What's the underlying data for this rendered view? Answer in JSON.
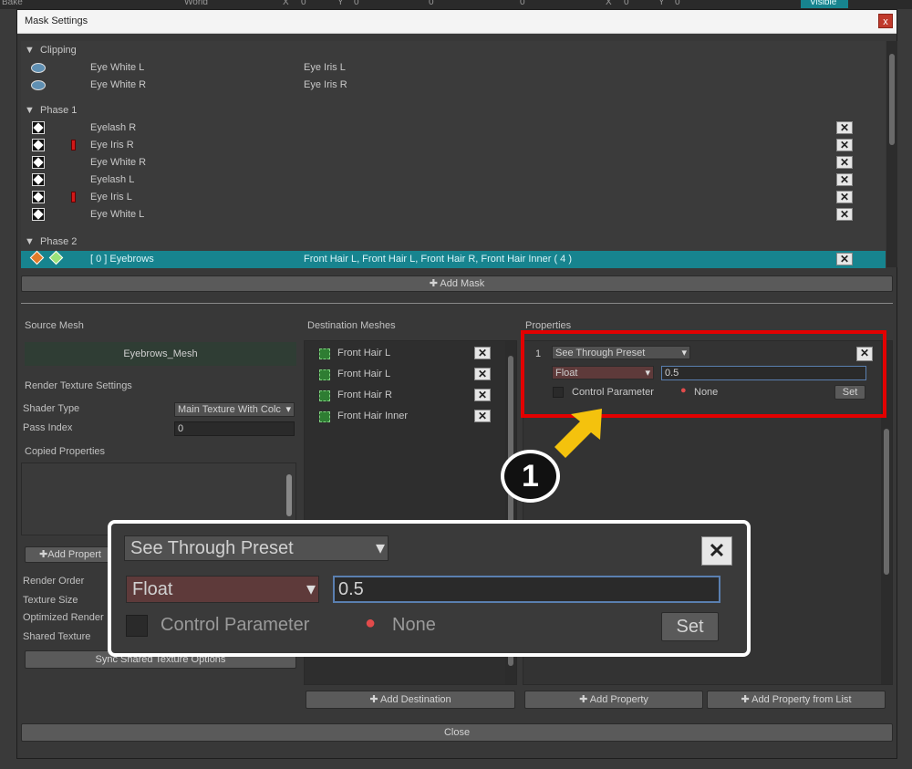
{
  "background_toolbar": {
    "bake": "Bake",
    "world": "World",
    "x": "X",
    "x_val": "0",
    "y": "Y",
    "y_val": "0",
    "zero_a": "0",
    "zero_b": "0",
    "x2": "X",
    "x2_val": "0",
    "y2": "Y",
    "y2_val": "0",
    "visible": "Visible"
  },
  "window": {
    "title": "Mask Settings",
    "close": "x"
  },
  "mask_list": {
    "clipping": {
      "header": "Clipping",
      "rows": [
        {
          "name": "Eye White L",
          "target": "Eye Iris L"
        },
        {
          "name": "Eye White R",
          "target": "Eye Iris R"
        }
      ]
    },
    "phase1": {
      "header": "Phase 1",
      "rows": [
        {
          "name": "Eyelash R",
          "warn": false
        },
        {
          "name": "Eye Iris R",
          "warn": true
        },
        {
          "name": "Eye White R",
          "warn": false
        },
        {
          "name": "Eyelash L",
          "warn": false
        },
        {
          "name": "Eye Iris L",
          "warn": true
        },
        {
          "name": "Eye White L",
          "warn": false
        }
      ]
    },
    "phase2": {
      "header": "Phase 2",
      "selected": {
        "name": "[ 0 ] Eyebrows",
        "targets": "Front Hair L, Front Hair L, Front Hair R, Front Hair Inner ( 4 )"
      }
    },
    "add_mask": "Add Mask"
  },
  "source": {
    "title": "Source Mesh",
    "mesh": "Eyebrows_Mesh",
    "rts_title": "Render Texture Settings",
    "shader_type_label": "Shader Type",
    "shader_type_value": "Main Texture With Colc",
    "pass_index_label": "Pass Index",
    "pass_index_value": "0",
    "copied_props": "Copied Properties",
    "add_prop_btn": "Add Propert",
    "render_order": "Render Order",
    "texture_size": "Texture Size",
    "optimized_render": "Optimized Render",
    "shared_texture": "Shared Texture",
    "sync_btn": "Sync Shared Texture Options"
  },
  "destination": {
    "title": "Destination Meshes",
    "items": [
      "Front Hair L",
      "Front Hair L",
      "Front Hair R",
      "Front Hair Inner"
    ],
    "add_btn": "Add Destination"
  },
  "properties": {
    "title": "Properties",
    "index": "1",
    "preset": "See Through Preset",
    "type": "Float",
    "value": "0.5",
    "control_param": "Control Parameter",
    "none": "None",
    "set": "Set",
    "add_btn": "Add Property",
    "add_list_btn": "Add Property from List"
  },
  "close_btn": "Close",
  "callout": {
    "number": "1"
  },
  "colors": {
    "accent_teal": "#17848f",
    "highlight_red": "#e30000",
    "arrow_yellow": "#f4c20d"
  }
}
